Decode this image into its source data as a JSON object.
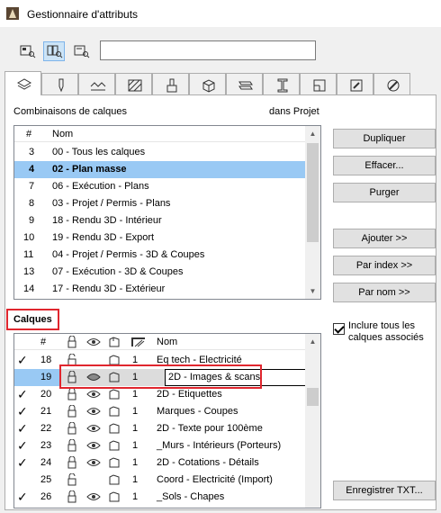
{
  "window": {
    "title": "Gestionnaire d'attributs"
  },
  "toolbar": {
    "search_value": ""
  },
  "combinations": {
    "label": "Combinaisons de calques",
    "context": "dans Projet",
    "headers": {
      "num": "#",
      "name": "Nom"
    },
    "rows": [
      {
        "num": "3",
        "name": "00 - Tous les calques"
      },
      {
        "num": "4",
        "name": "02 - Plan masse",
        "selected": true
      },
      {
        "num": "7",
        "name": "06 - Exécution - Plans"
      },
      {
        "num": "8",
        "name": "03 - Projet / Permis - Plans"
      },
      {
        "num": "9",
        "name": "18 - Rendu 3D - Intérieur"
      },
      {
        "num": "10",
        "name": "19 - Rendu 3D - Export"
      },
      {
        "num": "11",
        "name": "04 - Projet / Permis - 3D & Coupes"
      },
      {
        "num": "13",
        "name": "07 - Exécution - 3D & Coupes"
      },
      {
        "num": "14",
        "name": "17 - Rendu 3D - Extérieur"
      }
    ]
  },
  "buttons": {
    "duplicate": "Dupliquer",
    "clear": "Effacer...",
    "purge": "Purger",
    "add": "Ajouter >>",
    "by_index": "Par index >>",
    "by_name": "Par nom >>",
    "save_txt": "Enregistrer TXT..."
  },
  "include_all": {
    "label": "Inclure tous les calques associés",
    "checked": true
  },
  "layers": {
    "label": "Calques",
    "headers": {
      "num": "#",
      "name": "Nom"
    },
    "header_icons": [
      "lock-icon",
      "eye-icon",
      "wireframe-icon",
      "intersection-group-icon"
    ],
    "rows": [
      {
        "check": "✓",
        "num": "18",
        "lock": "open",
        "group": "1",
        "name": "Eq tech - Electricité"
      },
      {
        "check": "",
        "num": "19",
        "lock": "closed",
        "group": "1",
        "name": "2D - Images & scans",
        "selected": true
      },
      {
        "check": "✓",
        "num": "20",
        "lock": "closed",
        "group": "1",
        "name": "2D - Etiquettes"
      },
      {
        "check": "✓",
        "num": "21",
        "lock": "closed",
        "group": "1",
        "name": "Marques - Coupes"
      },
      {
        "check": "✓",
        "num": "22",
        "lock": "closed",
        "group": "1",
        "name": "2D - Texte pour 100ème"
      },
      {
        "check": "✓",
        "num": "23",
        "lock": "closed",
        "group": "1",
        "name": "_Murs - Intérieurs (Porteurs)"
      },
      {
        "check": "✓",
        "num": "24",
        "lock": "closed",
        "group": "1",
        "name": "2D - Cotations - Détails"
      },
      {
        "check": "",
        "num": "25",
        "lock": "open",
        "group": "1",
        "name": "Coord - Electricité (Import)"
      },
      {
        "check": "✓",
        "num": "26",
        "lock": "closed",
        "group": "1",
        "name": "_Sols - Chapes"
      }
    ]
  },
  "colors": {
    "selection": "#99c9f4",
    "highlight": "#e0262e",
    "accent": "#7eb4ea"
  }
}
